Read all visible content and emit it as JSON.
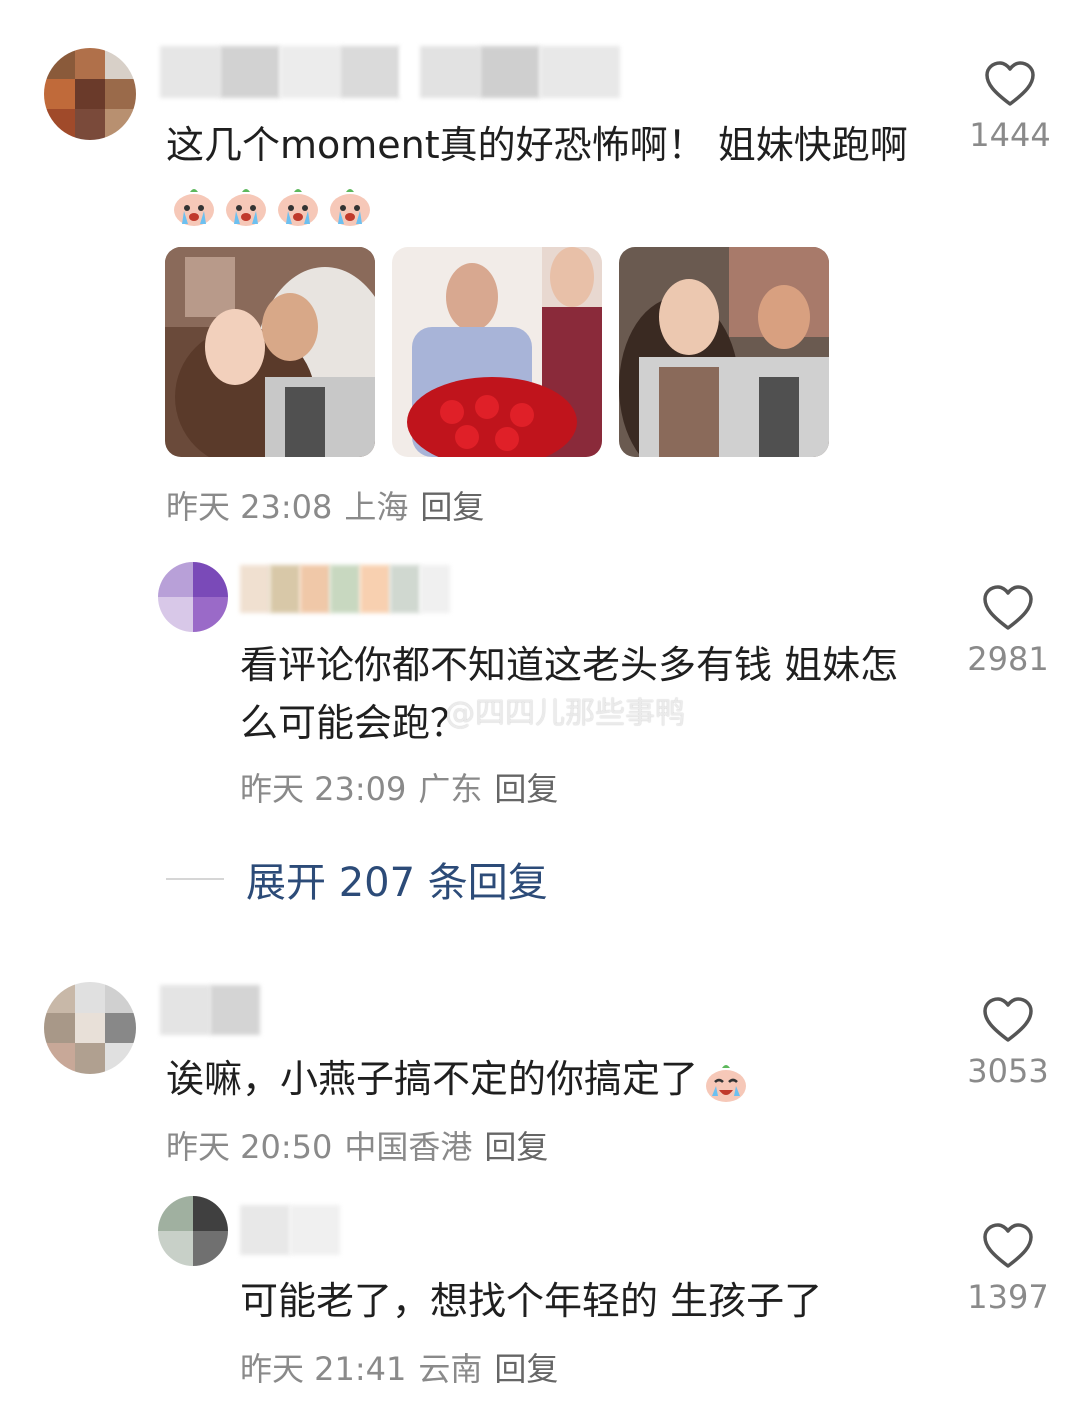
{
  "comments": [
    {
      "text": "这几个moment真的好恐怖啊！ 姐妹快跑啊",
      "time": "昨天 23:08",
      "location": "上海",
      "reply_label": "回复",
      "likes": "1444",
      "emojis": [
        "crying-emoji",
        "crying-emoji",
        "crying-emoji",
        "crying-emoji"
      ]
    },
    {
      "text": "看评论你都不知道这老头多有钱 姐妹怎么可能会跑？",
      "time": "昨天 23:09",
      "location": "广东",
      "reply_label": "回复",
      "likes": "2981"
    },
    {
      "text": "诶嘛，小燕子搞不定的你搞定了",
      "time": "昨天 20:50",
      "location": "中国香港",
      "reply_label": "回复",
      "likes": "3053"
    },
    {
      "text": "可能老了，想找个年轻的 生孩子了",
      "time": "昨天 21:41",
      "location": "云南",
      "reply_label": "回复",
      "likes": "1397"
    }
  ],
  "expand_replies": "展开 207 条回复",
  "watermark": "@四四儿那些事鸭",
  "colors": {
    "link": "#2c4b78",
    "meta": "#8a8a8a",
    "text": "#1f1f1f"
  }
}
